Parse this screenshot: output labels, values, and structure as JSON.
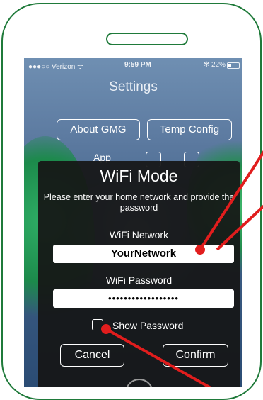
{
  "status_bar": {
    "carrier": "●●●○○ Verizon ᯤ",
    "time": "9:59 PM",
    "battery": "✻ 22%"
  },
  "settings": {
    "title": "Settings",
    "about_button": "About GMG",
    "temp_config_button": "Temp Config",
    "app_label": "App"
  },
  "dialog": {
    "title": "WiFi Mode",
    "message": "Please enter your home network and provide the password",
    "network_label": "WiFi Network",
    "network_value": "YourNetwork",
    "password_label": "WiFi Password",
    "password_value": "••••••••••••••••••",
    "show_password_label": "Show Password",
    "show_password_checked": false,
    "cancel_button": "Cancel",
    "confirm_button": "Confirm"
  },
  "colors": {
    "frame": "#1f7a3a",
    "annotation": "#e11d1d",
    "dialog_bg": "#161616"
  }
}
